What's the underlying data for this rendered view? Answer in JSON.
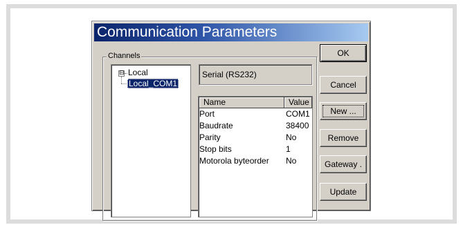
{
  "dialog": {
    "title": "Communication Parameters",
    "titlebar_colors": {
      "start": "#0a246a",
      "end": "#a6caf0"
    }
  },
  "channels": {
    "group_label": "Channels",
    "tree": {
      "expander": "⊟",
      "root": "Local",
      "child": "Local_COM1"
    }
  },
  "selected_channel": {
    "type": "Serial (RS232)"
  },
  "params": {
    "headers": {
      "name": "Name",
      "value": "Value"
    },
    "rows": [
      {
        "name": "Port",
        "value": "COM1"
      },
      {
        "name": "Baudrate",
        "value": "38400"
      },
      {
        "name": "Parity",
        "value": "No"
      },
      {
        "name": "Stop bits",
        "value": "1"
      },
      {
        "name": "Motorola byteorder",
        "value": "No"
      }
    ]
  },
  "buttons": {
    "ok": "OK",
    "cancel": "Cancel",
    "new": "New ...",
    "remove": "Remove",
    "gateway": "Gateway .",
    "update": "Update"
  }
}
